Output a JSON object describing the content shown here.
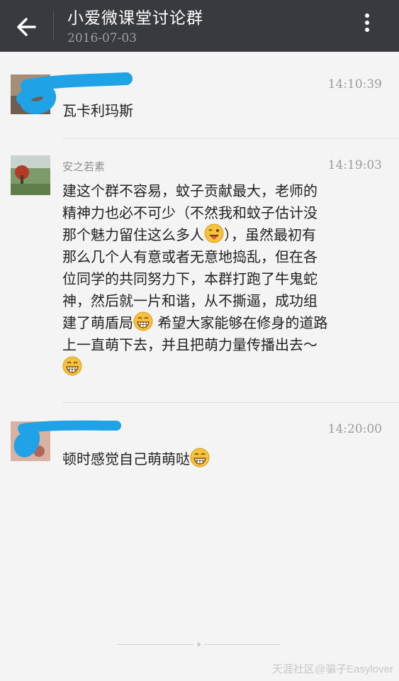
{
  "header": {
    "back_icon": "arrow-left-icon",
    "title": "小爱微课堂讨论群",
    "date": "2016-07-03",
    "more_icon": "more-vertical-icon"
  },
  "messages": [
    {
      "sender": "",
      "time": "14:10:39",
      "text": "瓦卡利玛斯"
    },
    {
      "sender": "安之若素",
      "time": "14:19:03",
      "lines": [
        "建这个群不容易，蚊子贡献最大，老师的",
        "精神力也必不可少（不然我和蚊子估计没",
        "那个魅力留住这么多人",
        "），虽然最初有",
        "那么几个人有意或者无意地捣乱，但在各",
        "位同学的共同努力下，本群打跑了牛鬼蛇",
        "神，然后就一片和谐，从不撕逼，成功组",
        "建了萌盾局",
        " 希望大家能够在修身的道路",
        "上一直萌下去，并且把萌力量传播出去～"
      ]
    },
    {
      "sender": "",
      "time": "14:20:00",
      "text": "顿时感觉自己萌萌哒"
    }
  ],
  "emojis": {
    "wink": "tongue-wink-emoji",
    "grin": "grin-emoji"
  },
  "watermark": "天涯社区@骗子Easylover",
  "colors": {
    "topbar": "#393a3f",
    "background": "#f4f4f4",
    "redaction": "#1fa3e6"
  }
}
